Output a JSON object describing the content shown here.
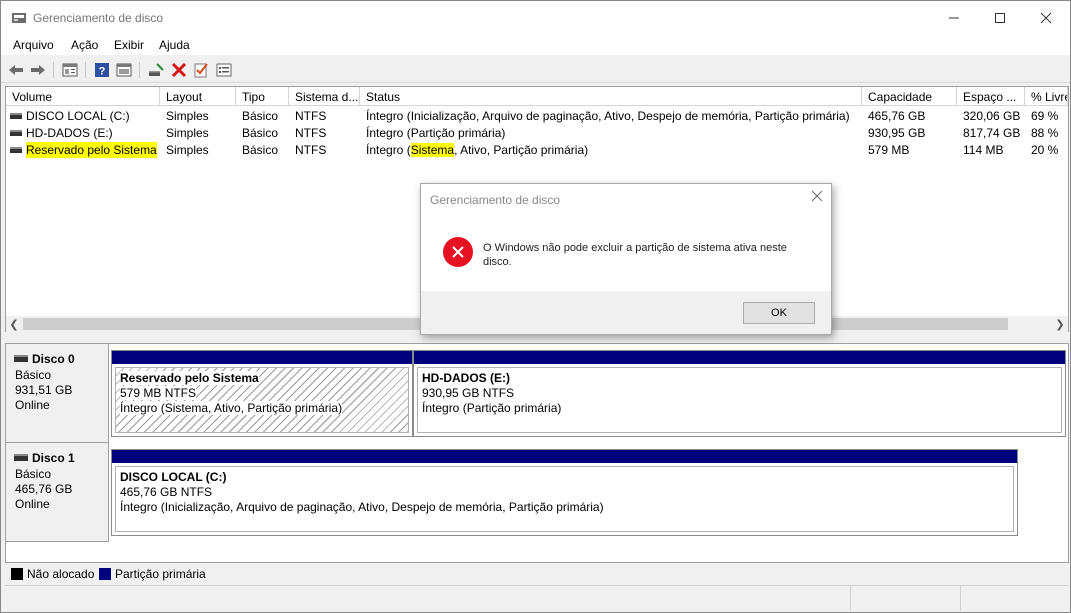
{
  "window": {
    "title": "Gerenciamento de disco"
  },
  "menu": [
    "Arquivo",
    "Ação",
    "Exibir",
    "Ajuda"
  ],
  "toolbar": {
    "icons": [
      "back-icon",
      "forward-icon",
      "properties-icon",
      "help-icon",
      "view-icon",
      "connect-icon",
      "delete-icon",
      "check-icon",
      "list-icon"
    ]
  },
  "volume_table": {
    "columns": [
      "Volume",
      "Layout",
      "Tipo",
      "Sistema d...",
      "Status",
      "Capacidade",
      "Espaço ...",
      "% Livre"
    ],
    "rows": [
      {
        "volume": "DISCO LOCAL (C:)",
        "layout": "Simples",
        "tipo": "Básico",
        "sistema": "NTFS",
        "status": "Íntegro (Inicialização, Arquivo de paginação, Ativo, Despejo de memória, Partição primária)",
        "capacidade": "465,76 GB",
        "espaco": "320,06 GB",
        "livre": "69 %"
      },
      {
        "volume": "HD-DADOS (E:)",
        "layout": "Simples",
        "tipo": "Básico",
        "sistema": "NTFS",
        "status": "Íntegro (Partição primária)",
        "capacidade": "930,95 GB",
        "espaco": "817,74 GB",
        "livre": "88 %"
      },
      {
        "volume": "Reservado pelo Sistema",
        "layout": "Simples",
        "tipo": "Básico",
        "sistema": "NTFS",
        "status_pre": "Íntegro (",
        "status_hl": "Sistema",
        "status_post": ", Ativo, Partição primária)",
        "capacidade": "579 MB",
        "espaco": "114 MB",
        "livre": "20 %"
      }
    ]
  },
  "dialog": {
    "title": "Gerenciamento de disco",
    "message": "O Windows não pode excluir a partição de sistema ativa neste disco.",
    "ok_label": "OK"
  },
  "disks": [
    {
      "name": "Disco 0",
      "type": "Básico",
      "size": "931,51 GB",
      "state": "Online",
      "partitions": [
        {
          "name": "Reservado pelo Sistema",
          "size": "579 MB NTFS",
          "status": "Íntegro (Sistema, Ativo, Partição primária)"
        },
        {
          "name": "HD-DADOS  (E:)",
          "size": "930,95 GB NTFS",
          "status": "Íntegro (Partição primária)"
        }
      ]
    },
    {
      "name": "Disco 1",
      "type": "Básico",
      "size": "465,76 GB",
      "state": "Online",
      "partitions": [
        {
          "name": "DISCO LOCAL  (C:)",
          "size": "465,76 GB NTFS",
          "status": "Íntegro (Inicialização, Arquivo de paginação, Ativo, Despejo de memória, Partição primária)"
        }
      ]
    }
  ],
  "legend": [
    {
      "label": "Não alocado",
      "color": "#000000"
    },
    {
      "label": "Partição primária",
      "color": "#00007e"
    }
  ],
  "colors": {
    "highlight": "#ffff00",
    "primary_partition": "#00007e",
    "error": "#e81123"
  }
}
